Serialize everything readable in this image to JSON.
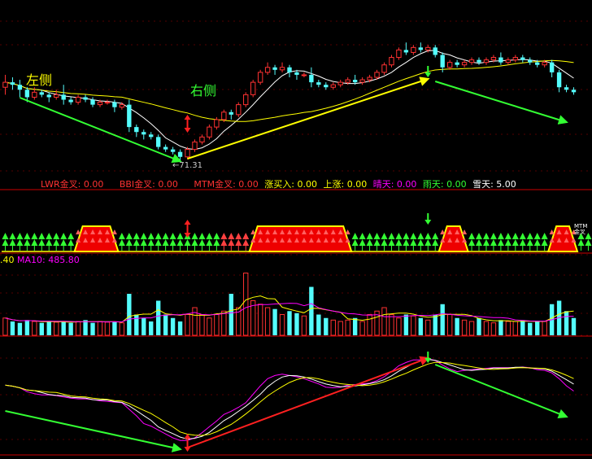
{
  "colors": {
    "background": "#000000",
    "up": "#ff3232",
    "down": "#54fcfc",
    "ma_white": "#ffffff",
    "ma_yellow": "#ffff00",
    "ma_magenta": "#ff00ff",
    "arrow_green": "#33ff33",
    "arrow_yellow": "#ffff00",
    "arrow_red": "#ff2020",
    "grid": "#aa0000"
  },
  "annotations": {
    "left_label": "左侧",
    "right_label": "右侧",
    "low_price": "←71.31"
  },
  "indicator_legend": [
    {
      "text": "LWR金叉: 0.00",
      "color": "#ff3232"
    },
    {
      "text": "BBI金叉: 0.00",
      "color": "#ff3232"
    },
    {
      "text": "MTM金叉: 0.00",
      "color": "#ff3232"
    },
    {
      "text": "涨买入: 0.00",
      "color": "#ffff00"
    },
    {
      "text": "上涨: 0.00",
      "color": "#ffff00"
    },
    {
      "text": "晴天: 0.00",
      "color": "#ff00ff"
    },
    {
      "text": "雨天: 0.00",
      "color": "#33ff33"
    },
    {
      "text": "雪天: 5.00",
      "color": "#ffffff"
    }
  ],
  "volume_legend": {
    "first": ".40",
    "ma10": "MA10: 485.80"
  },
  "side_label": "MTM金叉",
  "chart_data": {
    "type": "candlestick",
    "low_marker": 71.31,
    "candles": [
      [
        0.7,
        0.72,
        0.67,
        0.75
      ],
      [
        0.72,
        0.71,
        0.69,
        0.74
      ],
      [
        0.71,
        0.69,
        0.66,
        0.73
      ],
      [
        0.69,
        0.66,
        0.64,
        0.7
      ],
      [
        0.66,
        0.68,
        0.65,
        0.7
      ],
      [
        0.68,
        0.67,
        0.66,
        0.69
      ],
      [
        0.67,
        0.66,
        0.64,
        0.68
      ],
      [
        0.66,
        0.67,
        0.65,
        0.69
      ],
      [
        0.67,
        0.65,
        0.63,
        0.71
      ],
      [
        0.65,
        0.64,
        0.63,
        0.66
      ],
      [
        0.64,
        0.66,
        0.63,
        0.67
      ],
      [
        0.66,
        0.65,
        0.64,
        0.67
      ],
      [
        0.65,
        0.63,
        0.62,
        0.66
      ],
      [
        0.63,
        0.64,
        0.62,
        0.65
      ],
      [
        0.64,
        0.64,
        0.63,
        0.65
      ],
      [
        0.64,
        0.62,
        0.6,
        0.65
      ],
      [
        0.62,
        0.63,
        0.61,
        0.64
      ],
      [
        0.63,
        0.54,
        0.52,
        0.65
      ],
      [
        0.54,
        0.52,
        0.5,
        0.55
      ],
      [
        0.52,
        0.51,
        0.49,
        0.53
      ],
      [
        0.51,
        0.5,
        0.49,
        0.52
      ],
      [
        0.5,
        0.46,
        0.45,
        0.51
      ],
      [
        0.46,
        0.45,
        0.44,
        0.47
      ],
      [
        0.45,
        0.44,
        0.43,
        0.46
      ],
      [
        0.44,
        0.42,
        0.4,
        0.45
      ],
      [
        0.42,
        0.45,
        0.41,
        0.46
      ],
      [
        0.45,
        0.48,
        0.44,
        0.49
      ],
      [
        0.48,
        0.5,
        0.47,
        0.51
      ],
      [
        0.5,
        0.54,
        0.49,
        0.55
      ],
      [
        0.54,
        0.57,
        0.53,
        0.58
      ],
      [
        0.57,
        0.6,
        0.56,
        0.61
      ],
      [
        0.6,
        0.59,
        0.57,
        0.61
      ],
      [
        0.59,
        0.63,
        0.58,
        0.64
      ],
      [
        0.63,
        0.67,
        0.62,
        0.68
      ],
      [
        0.67,
        0.72,
        0.66,
        0.73
      ],
      [
        0.72,
        0.76,
        0.71,
        0.77
      ],
      [
        0.76,
        0.78,
        0.75,
        0.8
      ],
      [
        0.78,
        0.77,
        0.75,
        0.79
      ],
      [
        0.77,
        0.78,
        0.76,
        0.8
      ],
      [
        0.78,
        0.76,
        0.74,
        0.79
      ],
      [
        0.76,
        0.75,
        0.73,
        0.77
      ],
      [
        0.75,
        0.75,
        0.74,
        0.76
      ],
      [
        0.75,
        0.72,
        0.7,
        0.78
      ],
      [
        0.72,
        0.71,
        0.7,
        0.73
      ],
      [
        0.71,
        0.7,
        0.69,
        0.72
      ],
      [
        0.7,
        0.71,
        0.69,
        0.72
      ],
      [
        0.71,
        0.72,
        0.7,
        0.73
      ],
      [
        0.72,
        0.73,
        0.71,
        0.74
      ],
      [
        0.73,
        0.72,
        0.71,
        0.75
      ],
      [
        0.72,
        0.73,
        0.71,
        0.74
      ],
      [
        0.73,
        0.74,
        0.72,
        0.75
      ],
      [
        0.74,
        0.76,
        0.73,
        0.77
      ],
      [
        0.76,
        0.79,
        0.75,
        0.8
      ],
      [
        0.79,
        0.82,
        0.78,
        0.83
      ],
      [
        0.82,
        0.85,
        0.81,
        0.86
      ],
      [
        0.85,
        0.84,
        0.83,
        0.88
      ],
      [
        0.84,
        0.86,
        0.83,
        0.87
      ],
      [
        0.86,
        0.85,
        0.84,
        0.88
      ],
      [
        0.85,
        0.86,
        0.84,
        0.87
      ],
      [
        0.86,
        0.83,
        0.82,
        0.87
      ],
      [
        0.83,
        0.78,
        0.76,
        0.84
      ],
      [
        0.78,
        0.8,
        0.77,
        0.81
      ],
      [
        0.8,
        0.79,
        0.78,
        0.81
      ],
      [
        0.79,
        0.8,
        0.78,
        0.81
      ],
      [
        0.8,
        0.81,
        0.79,
        0.82
      ],
      [
        0.81,
        0.8,
        0.79,
        0.82
      ],
      [
        0.8,
        0.81,
        0.79,
        0.82
      ],
      [
        0.81,
        0.82,
        0.8,
        0.83
      ],
      [
        0.82,
        0.8,
        0.79,
        0.84
      ],
      [
        0.8,
        0.81,
        0.79,
        0.82
      ],
      [
        0.81,
        0.82,
        0.8,
        0.83
      ],
      [
        0.82,
        0.81,
        0.8,
        0.83
      ],
      [
        0.81,
        0.8,
        0.79,
        0.82
      ],
      [
        0.8,
        0.79,
        0.78,
        0.81
      ],
      [
        0.79,
        0.8,
        0.78,
        0.81
      ],
      [
        0.8,
        0.76,
        0.74,
        0.81
      ],
      [
        0.76,
        0.7,
        0.68,
        0.77
      ],
      [
        0.7,
        0.69,
        0.68,
        0.71
      ],
      [
        0.69,
        0.68,
        0.67,
        0.7
      ]
    ],
    "volume": [
      0.25,
      0.2,
      0.18,
      0.22,
      0.2,
      0.18,
      0.2,
      0.19,
      0.2,
      0.18,
      0.2,
      0.22,
      0.18,
      0.2,
      0.19,
      0.2,
      0.18,
      0.6,
      0.3,
      0.25,
      0.2,
      0.5,
      0.3,
      0.25,
      0.2,
      0.3,
      0.4,
      0.3,
      0.25,
      0.3,
      0.35,
      0.6,
      0.4,
      0.9,
      0.5,
      0.45,
      0.4,
      0.38,
      0.3,
      0.35,
      0.32,
      0.28,
      0.7,
      0.3,
      0.25,
      0.22,
      0.2,
      0.22,
      0.25,
      0.2,
      0.3,
      0.35,
      0.4,
      0.3,
      0.25,
      0.3,
      0.28,
      0.25,
      0.22,
      0.3,
      0.45,
      0.3,
      0.25,
      0.22,
      0.2,
      0.25,
      0.2,
      0.18,
      0.22,
      0.2,
      0.2,
      0.22,
      0.18,
      0.2,
      0.2,
      0.45,
      0.5,
      0.35,
      0.25
    ],
    "weather": [
      {
        "state": "snow",
        "count": 10
      },
      {
        "state": "up",
        "count": 6
      },
      {
        "state": "snow",
        "count": 14
      },
      {
        "state": "rain",
        "count": 4
      },
      {
        "state": "up",
        "count": 14
      },
      {
        "state": "snow",
        "count": 12
      },
      {
        "state": "up",
        "count": 4
      },
      {
        "state": "snow",
        "count": 11
      },
      {
        "state": "up",
        "count": 4
      },
      {
        "state": "snow",
        "count": 6
      }
    ]
  }
}
